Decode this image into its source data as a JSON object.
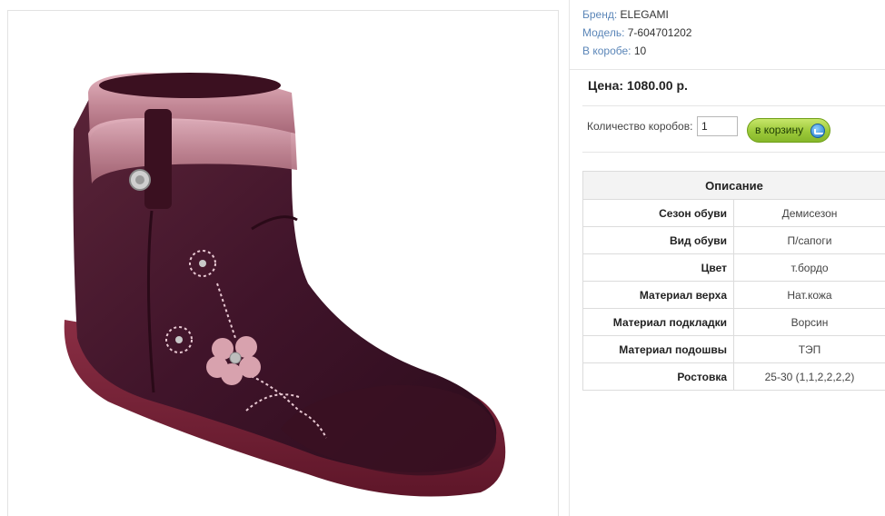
{
  "product_image": {
    "alt": "boot-photo"
  },
  "info": {
    "brand_label": "Бренд:",
    "brand_value": "ELEGAMI",
    "model_label": "Модель:",
    "model_value": "7-604701202",
    "box_label": "В коробе:",
    "box_value": "10"
  },
  "price_text": "Цена: 1080.00 р.",
  "order": {
    "qty_label": "Количество коробов:",
    "qty_value": "1",
    "cart_label": "в корзину"
  },
  "description": {
    "header": "Описание",
    "rows": [
      {
        "key": "Сезон обуви",
        "value": "Демисезон"
      },
      {
        "key": "Вид обуви",
        "value": "П/сапоги"
      },
      {
        "key": "Цвет",
        "value": "т.бордо"
      },
      {
        "key": "Материал верха",
        "value": "Нат.кожа"
      },
      {
        "key": "Материал подкладки",
        "value": "Ворсин"
      },
      {
        "key": "Материал подошвы",
        "value": "ТЭП"
      },
      {
        "key": "Ростовка",
        "value": "25-30 (1,1,2,2,2,2)"
      }
    ]
  },
  "colors": {
    "link_blue": "#5b86b8",
    "button_green": "#9cc93a",
    "boot_burgundy": "#4a1a2c",
    "boot_collar_pink": "#c98c9a"
  }
}
